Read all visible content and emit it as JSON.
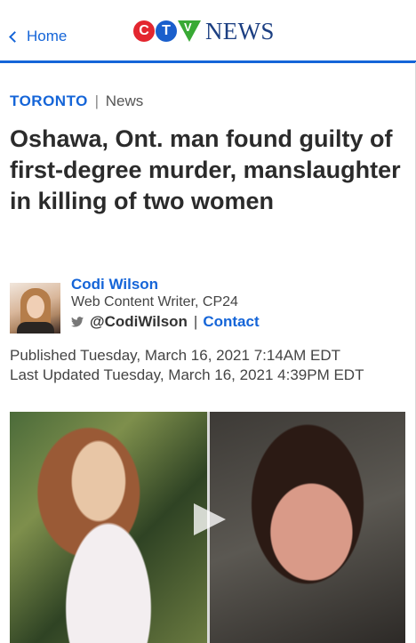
{
  "nav": {
    "back_label": "Home"
  },
  "logo": {
    "letters": [
      "C",
      "T",
      "V"
    ],
    "wordmark": "NEWS"
  },
  "section": {
    "topic": "TORONTO",
    "separator": "|",
    "category": "News"
  },
  "article": {
    "headline": "Oshawa, Ont. man found guilty of first-degree murder, manslaughter in killing of two women",
    "author": {
      "name": "Codi Wilson",
      "title": "Web Content Writer, CP24",
      "twitter_handle": "@CodiWilson",
      "separator": "|",
      "contact_label": "Contact"
    },
    "published": "Published Tuesday, March 16, 2021 7:14AM EDT",
    "updated": "Last Updated Tuesday, March 16, 2021 4:39PM EDT"
  },
  "colors": {
    "accent": "#1565d8",
    "ctv_red": "#e3262f",
    "ctv_blue": "#1a5fcc",
    "ctv_green": "#39a935",
    "news_navy": "#1c3f82"
  },
  "icons": {
    "back": "chevron-left-icon",
    "social": "twitter-icon",
    "media": "play-icon"
  }
}
